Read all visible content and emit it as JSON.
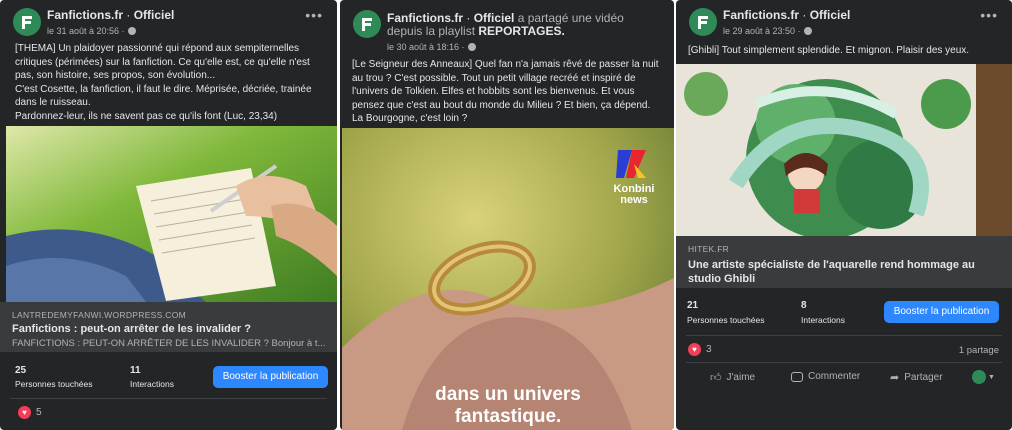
{
  "page": {
    "name": "Fanfictions.fr",
    "separator": " · ",
    "suffix": "Officiel"
  },
  "colors": {
    "card_bg": "#242526",
    "accent": "#2d88ff",
    "heart": "#f33e58",
    "avatar": "#2e8b57"
  },
  "posts": [
    {
      "time": "le 31 août à 20:56 ·",
      "text": [
        "[THEMA] Un plaidoyer passionné qui répond aux sempiternelles critiques (périmées) sur la fanfiction. Ce qu'elle est, ce qu'elle n'est pas, son histoire, ses propos, son évolution...",
        "C'est Cosette, la fanfiction, il faut le dire. Méprisée, décriée, trainée dans le ruisseau.",
        "Pardonnez-leur, ils ne savent pas ce qu'ils font (Luc, 23,34)"
      ],
      "link": {
        "domain": "LANTREDEMYFANWI.WORDPRESS.COM",
        "title": "Fanfictions : peut-on arrêter de les invalider ?",
        "desc": "FANFICTIONS : PEUT-ON ARRÊTER DE LES INVALIDER ? Bonjour à t..."
      },
      "stats": {
        "reach": "25",
        "reach_label": "Personnes touchées",
        "interactions": "11",
        "interactions_label": "Interactions"
      },
      "boost_label": "Booster la publication",
      "reactions": "5"
    },
    {
      "shared": " a partagé une vidéo depuis la playlist ",
      "playlist": "REPORTAGES.",
      "time": "le 30 août à 18:16 ·",
      "text": [
        "[Le Seigneur des Anneaux] Quel fan n'a jamais rêvé de passer la nuit au trou ? C'est possible. Tout un petit village recréé et inspiré de l'univers de Tolkien. Elfes et hobbits sont les bienvenus. Et vous pensez que c'est au bout du monde du Milieu ? Et bien, ça dépend. La Bourgogne, c'est loin ?"
      ],
      "video": {
        "brand1": "Konbini",
        "brand2": "news",
        "caption1": "dans un univers",
        "caption2": "fantastique."
      }
    },
    {
      "time": "le 29 août à 23:50 ·",
      "text": [
        "[Ghibli] Tout simplement splendide. Et mignon. Plaisir des yeux."
      ],
      "link": {
        "domain": "HITEK.FR",
        "title": "Une artiste spécialiste de l'aquarelle rend hommage au studio Ghibli"
      },
      "stats": {
        "reach": "21",
        "reach_label": "Personnes touchées",
        "interactions": "8",
        "interactions_label": "Interactions"
      },
      "boost_label": "Booster la publication",
      "reactions": "3",
      "shares": "1 partage",
      "actions": {
        "like": "J'aime",
        "comment": "Commenter",
        "share": "Partager"
      }
    }
  ]
}
